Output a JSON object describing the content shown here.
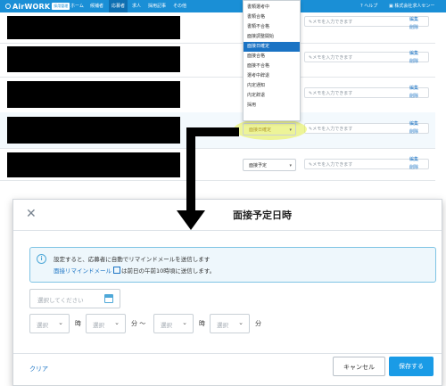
{
  "header": {
    "logo_text": "AirWORK",
    "logo_badge": "採用管理",
    "nav_items": [
      "ホーム",
      "候補者",
      "応募者",
      "求人",
      "採用記事",
      "その他"
    ],
    "active_nav_index": 2,
    "help_label": "ヘルプ",
    "company_label": "株式会社求人センー"
  },
  "table": {
    "memo_placeholder": "メモを入力できます",
    "row_links": [
      "編集",
      "削除"
    ],
    "selected_status": "面接日確定",
    "status_placeholder": "面接予定"
  },
  "status_dropdown": {
    "options": [
      "書類選考中",
      "書類合格",
      "書類不合格",
      "面接調整開始",
      "面接日確定",
      "面接合格",
      "面接不合格",
      "選考中辞退",
      "内定通知",
      "内定辞退",
      "採用"
    ],
    "selected_index": 4
  },
  "modal": {
    "title": "面接予定日時",
    "info_line1": "設定すると、応募者に自動でリマインドメールを送信します",
    "info_link": "面接リマインドメール",
    "info_line2_rest": "は前日の午前10時頃に送信します。",
    "date_placeholder": "選択してください",
    "time_placeholder": "選択",
    "unit_hour": "時",
    "unit_minute_from": "分 〜",
    "unit_minute": "分",
    "clear_label": "クリア",
    "cancel_label": "キャンセル",
    "save_label": "保存する"
  },
  "colors": {
    "nav": "#1a8fd6",
    "accent": "#1a73c4",
    "save_button": "#1a9be6",
    "highlight": "#e8f046"
  }
}
